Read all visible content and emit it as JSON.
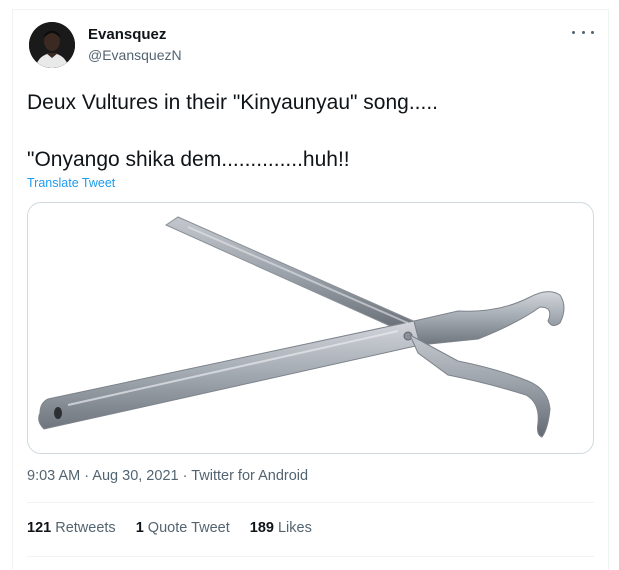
{
  "tweet": {
    "author_name": "Evansquez",
    "author_handle": "@EvansquezN",
    "line1": "Deux Vultures in their \"Kinyaunyau\" song.....",
    "line2": "\"Onyango shika dem..............huh!!",
    "translate_label": "Translate Tweet",
    "time": "9:03 AM",
    "separator": " · ",
    "date": "Aug 30, 2021",
    "source": "Twitter for Android"
  },
  "stats": {
    "retweets_count": "121",
    "retweets_label": "Retweets",
    "quotes_count": "1",
    "quotes_label": "Quote Tweet",
    "likes_count": "189",
    "likes_label": "Likes"
  },
  "colors": {
    "link": "#1d9bf0",
    "secondary_text": "#536471",
    "primary_text": "#0f1419"
  },
  "icons": {
    "more": "more-options-icon"
  }
}
